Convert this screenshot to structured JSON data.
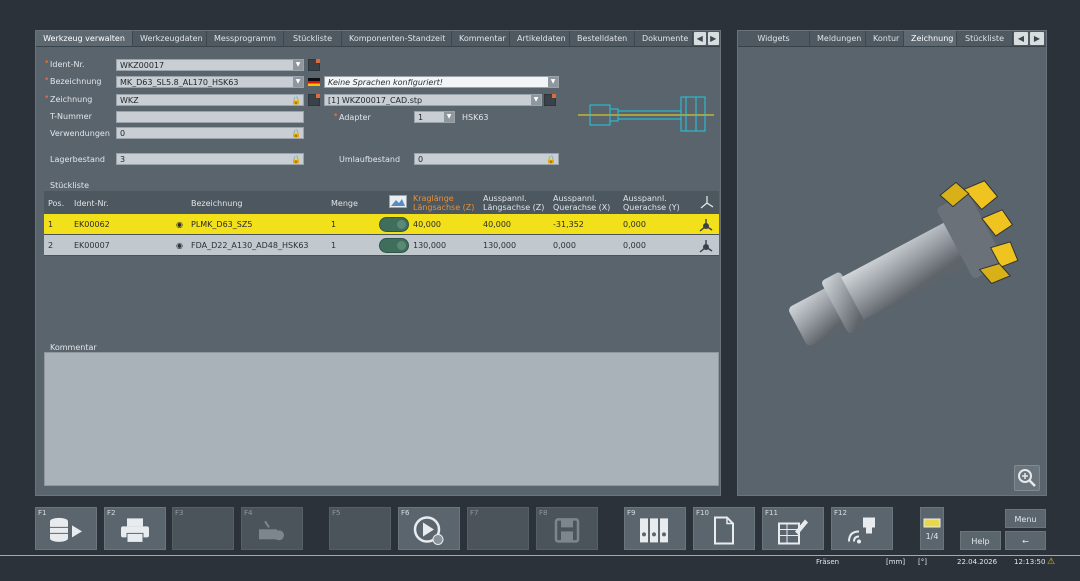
{
  "left_tabs": [
    "Werkzeug verwalten",
    "Werkzeugdaten",
    "Messprogramm",
    "Stückliste",
    "Komponenten-Standzeit",
    "Kommentar",
    "Artikeldaten",
    "Bestelldaten",
    "Dokumente"
  ],
  "right_tabs": [
    "Widgets",
    "Meldungen",
    "Kontur",
    "Zeichnung",
    "Stückliste"
  ],
  "form": {
    "ident_label": "Ident-Nr.",
    "ident_value": "WKZ00017",
    "bez_label": "Bezeichnung",
    "bez_value": "MK_D63_SL5.8_AL170_HSK63",
    "lang_value": "Keine Sprachen konfiguriert!",
    "zeich_label": "Zeichnung",
    "zeich_value": "WKZ",
    "cad_value": "[1] WKZ00017_CAD.stp",
    "tnum_label": "T-Nummer",
    "tnum_value": "",
    "adapter_label": "Adapter",
    "adapter_value": "1",
    "adapter_type": "HSK63",
    "verw_label": "Verwendungen",
    "verw_value": "0",
    "lager_label": "Lagerbestand",
    "lager_value": "3",
    "umlauf_label": "Umlaufbestand",
    "umlauf_value": "0"
  },
  "stueckliste": {
    "title": "Stückliste",
    "headers": {
      "pos": "Pos.",
      "ident": "Ident-Nr.",
      "bez": "Bezeichnung",
      "menge": "Menge",
      "krag1": "Kraglänge",
      "krag2": "Längsachse (Z)",
      "al1": "Ausspannl.",
      "al2": "Längsachse (Z)",
      "aq1": "Ausspannl.",
      "aq2": "Querachse (X)",
      "ay1": "Ausspannl.",
      "ay2": "Querachse (Y)"
    },
    "rows": [
      {
        "pos": "1",
        "ident": "EK00062",
        "bez": "PLMK_D63_SZ5",
        "menge": "1",
        "krag": "40,000",
        "al": "40,000",
        "aq": "-31,352",
        "ay": "0,000"
      },
      {
        "pos": "2",
        "ident": "EK00007",
        "bez": "FDA_D22_A130_AD48_HSK63",
        "menge": "1",
        "krag": "130,000",
        "al": "130,000",
        "aq": "0,000",
        "ay": "0,000"
      }
    ]
  },
  "comment_label": "Kommentar",
  "fkeys": [
    "F1",
    "F2",
    "F3",
    "F4",
    "F5",
    "F6",
    "F7",
    "F8",
    "F9",
    "F10",
    "F11",
    "F12"
  ],
  "side": {
    "page": "1/4",
    "menu": "Menu",
    "help": "Help",
    "back": "←"
  },
  "status": {
    "mode": "Fräsen",
    "unit1": "[mm]",
    "unit2": "[°]",
    "date": "22.04.2026",
    "time": "12:13:50"
  },
  "colors": {
    "accent_yellow": "#f2e01a",
    "krag_orange": "#e8903a",
    "status_warn": "#e8c400"
  }
}
